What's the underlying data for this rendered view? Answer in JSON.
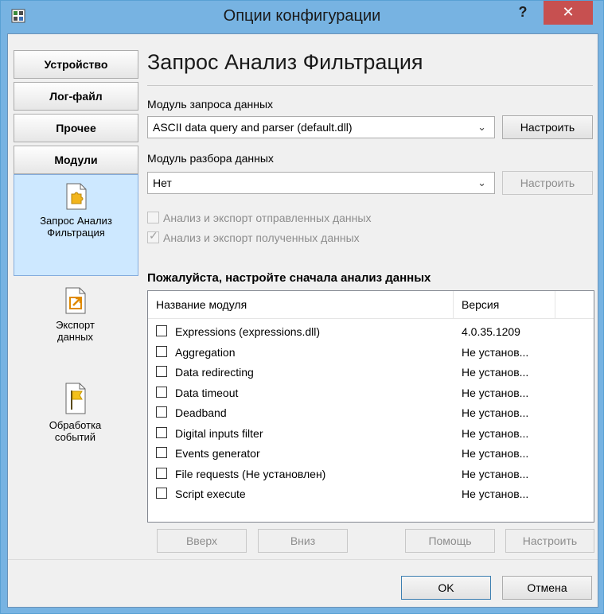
{
  "window": {
    "title": "Опции конфигурации",
    "help": "?",
    "close": "✕"
  },
  "sidebar": {
    "buttons": [
      "Устройство",
      "Лог-файл",
      "Прочее",
      "Модули"
    ],
    "items": [
      {
        "line1": "Запрос Анализ",
        "line2": "Фильтрация",
        "icon": "puzzle-icon",
        "active": true
      },
      {
        "line1": "Экспорт",
        "line2": "данных",
        "icon": "export-icon",
        "active": false
      },
      {
        "line1": "Обработка",
        "line2": "событий",
        "icon": "flag-icon",
        "active": false
      }
    ]
  },
  "main": {
    "heading": "Запрос Анализ Фильтрация",
    "query_label": "Модуль запроса данных",
    "query_value": "ASCII data query and parser (default.dll)",
    "query_configure": "Настроить",
    "parse_label": "Модуль разбора данных",
    "parse_value": "Нет",
    "parse_configure": "Настроить",
    "chk_sent": "Анализ и экспорт отправленных данных",
    "chk_received": "Анализ и экспорт полученных данных",
    "notice": "Пожалуйста, настройте сначала анализ данных",
    "list": {
      "col_name": "Название модуля",
      "col_version": "Версия",
      "rows": [
        {
          "name": "Expressions (expressions.dll)",
          "version": "4.0.35.1209"
        },
        {
          "name": "Aggregation",
          "version": "Не установ..."
        },
        {
          "name": "Data redirecting",
          "version": "Не установ..."
        },
        {
          "name": "Data timeout",
          "version": "Не установ..."
        },
        {
          "name": "Deadband",
          "version": "Не установ..."
        },
        {
          "name": "Digital inputs filter",
          "version": "Не установ..."
        },
        {
          "name": "Events generator",
          "version": "Не установ..."
        },
        {
          "name": "File requests (Не установлен)",
          "version": "Не установ..."
        },
        {
          "name": "Script execute",
          "version": "Не установ..."
        }
      ]
    },
    "btn_up": "Вверх",
    "btn_down": "Вниз",
    "btn_help": "Помощь",
    "btn_configure": "Настроить"
  },
  "footer": {
    "ok": "OK",
    "cancel": "Отмена"
  }
}
